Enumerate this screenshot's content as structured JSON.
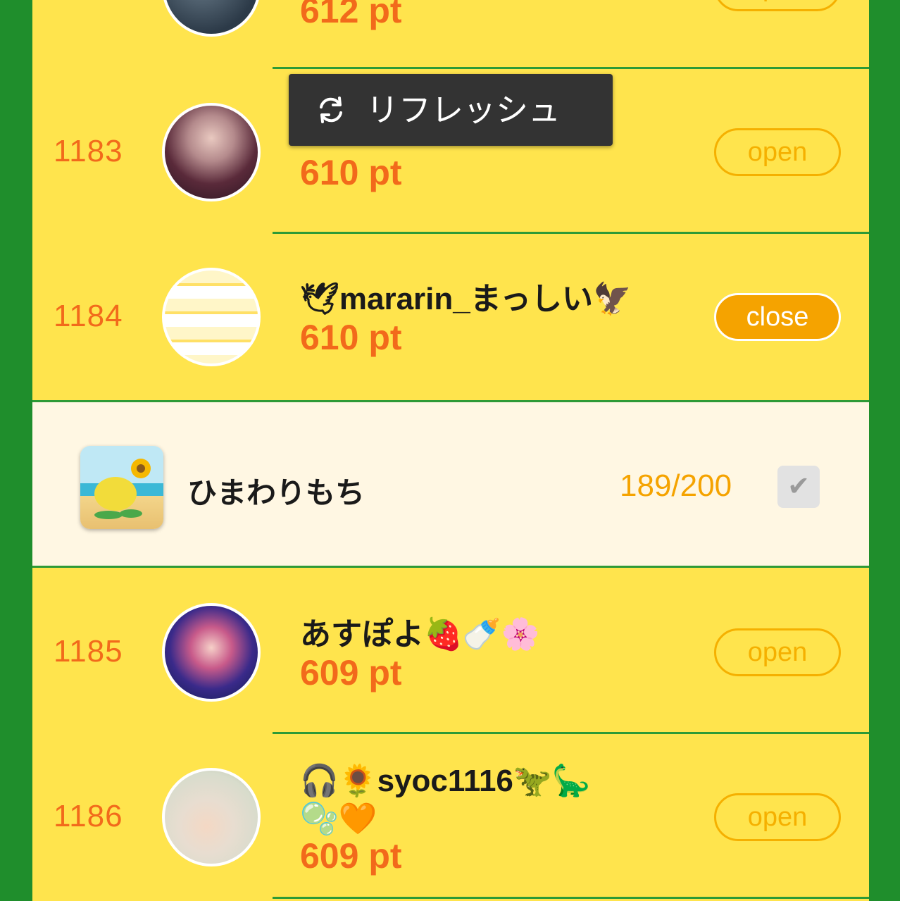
{
  "tooltip": {
    "label": "リフレッシュ",
    "icon": "refresh-icon"
  },
  "rows": [
    {
      "rank": "",
      "name": "",
      "points": "612 pt",
      "button": "open"
    },
    {
      "rank": "1183",
      "name": "",
      "points": "610 pt",
      "button": "open"
    },
    {
      "rank": "1184",
      "name": "🕊mararin_まっしい🦅",
      "points": "610 pt",
      "button": "close"
    },
    {
      "rank": "1185",
      "name": "あすぽよ🍓🍼🌸",
      "points": "609 pt",
      "button": "open"
    },
    {
      "rank": "1186",
      "name_line1": "🎧🌻syoc1116🦖🦕",
      "name_line2": "🫧🧡",
      "points": "609 pt",
      "button": "open"
    }
  ],
  "self": {
    "name": "ひまわりもち",
    "count": "189/200",
    "check_icon": "check-icon"
  },
  "colors": {
    "background": "#1f8e2c",
    "panel": "#ffe44d",
    "rank": "#f26a1b",
    "points": "#f26a1b",
    "accent": "#f5a300",
    "self_row": "#fff7e3"
  }
}
